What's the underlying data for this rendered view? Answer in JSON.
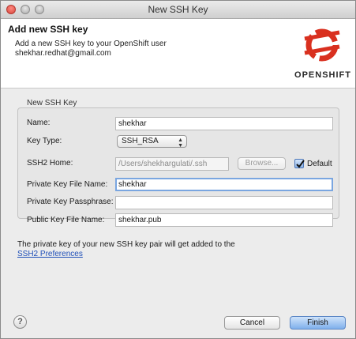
{
  "window": {
    "title": "New SSH Key"
  },
  "header": {
    "title": "Add new SSH key",
    "description": "Add a new SSH key to your OpenShift user shekhar.redhat@gmail.com",
    "logo_text": "OPENSHIFT",
    "brand_color": "#d9301f"
  },
  "group": {
    "label": "New SSH Key"
  },
  "form": {
    "name": {
      "label": "Name:",
      "value": "shekhar"
    },
    "key_type": {
      "label": "Key Type:",
      "value": "SSH_RSA"
    },
    "ssh2_home": {
      "label": "SSH2 Home:",
      "value": "/Users/shekhargulati/.ssh",
      "browse_label": "Browse...",
      "default_label": "Default",
      "default_checked": true
    },
    "private_key_file": {
      "label": "Private Key File Name:",
      "value": "shekhar"
    },
    "passphrase": {
      "label": "Private Key Passphrase:",
      "value": ""
    },
    "public_key_file": {
      "label": "Public Key File Name:",
      "value": "shekhar.pub"
    }
  },
  "info": {
    "text": "The private key of your new SSH key pair will get added to the",
    "link": "SSH2 Preferences"
  },
  "buttons": {
    "help": "?",
    "cancel": "Cancel",
    "finish": "Finish"
  }
}
